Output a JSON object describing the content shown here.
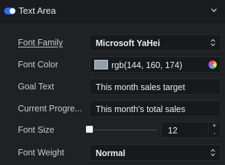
{
  "section": {
    "title": "Text Area",
    "enabled": true,
    "accent": "#2f6cf6"
  },
  "fields": {
    "font_family": {
      "label": "Font Family",
      "value": "Microsoft YaHei"
    },
    "font_color": {
      "label": "Font Color",
      "value": "rgb(144, 160, 174)",
      "swatch": "#90a0ae"
    },
    "goal_text": {
      "label": "Goal Text",
      "value": "This month sales target"
    },
    "current_progress": {
      "label": "Current Progre...",
      "value": "This month's total sales"
    },
    "font_size": {
      "label": "Font Size",
      "value": "12",
      "slider_fraction": 0.0,
      "increment": "+",
      "decrement": "-"
    },
    "font_weight": {
      "label": "Font Weight",
      "value": "Normal"
    }
  },
  "icons": {
    "collapse": "chevron-down-icon",
    "select_arrows": "updown-arrows-icon",
    "color_picker": "color-wheel-icon"
  }
}
